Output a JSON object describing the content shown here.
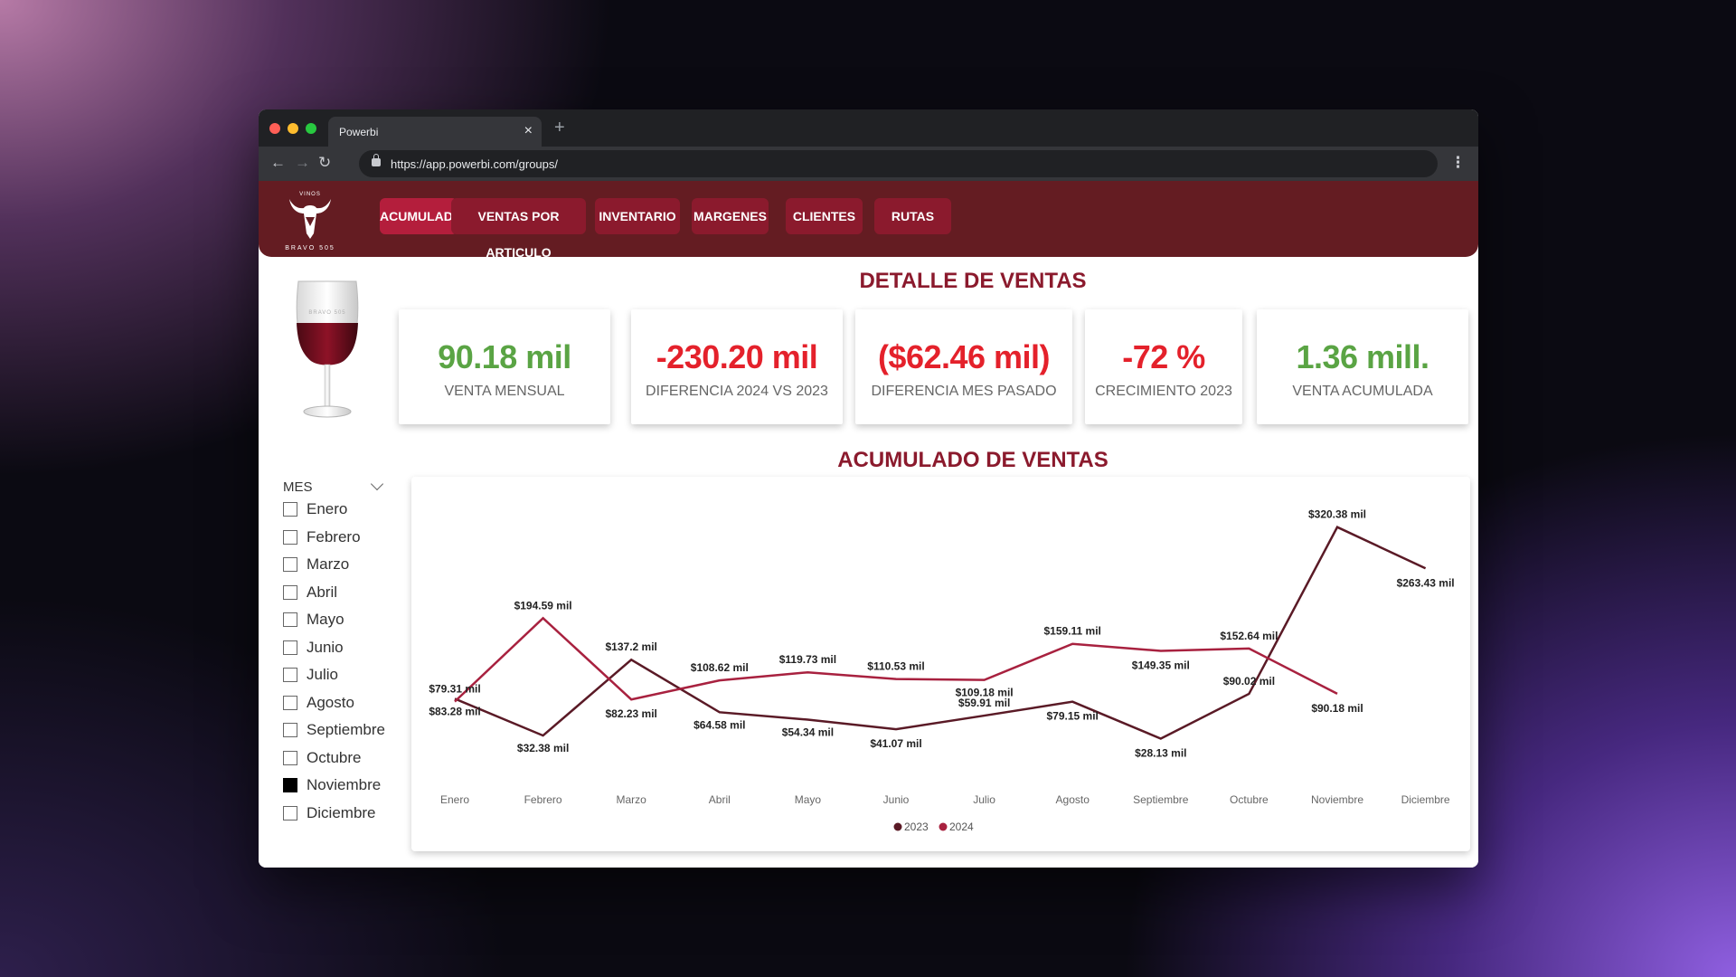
{
  "browser": {
    "tab_title": "Powerbi",
    "url": "https://app.powerbi.com/groups/"
  },
  "brand": {
    "logo_top": "VINOS",
    "logo_bottom": "BRAVO 505"
  },
  "nav": {
    "items": [
      {
        "label": "ACUMULADO",
        "active": true
      },
      {
        "label": "VENTAS POR ARTICULO",
        "active": false
      },
      {
        "label": "INVENTARIO",
        "active": false
      },
      {
        "label": "MARGENES",
        "active": false
      },
      {
        "label": "CLIENTES",
        "active": false
      },
      {
        "label": "RUTAS",
        "active": false
      }
    ]
  },
  "detail_title": "DETALLE DE VENTAS",
  "glass_text": "BRAVO 505",
  "kpis": [
    {
      "value": "90.18 mil",
      "label": "VENTA MENSUAL",
      "color": "#5aa444"
    },
    {
      "value": "-230.20 mil",
      "label": "DIFERENCIA 2024 VS 2023",
      "color": "#e4212b"
    },
    {
      "value": "($62.46 mil)",
      "label": "DIFERENCIA MES PASADO",
      "color": "#e4212b"
    },
    {
      "value": "-72 %",
      "label": "CRECIMIENTO 2023",
      "color": "#e4212b"
    },
    {
      "value": "1.36 mill.",
      "label": "VENTA ACUMULADA",
      "color": "#5aa444"
    }
  ],
  "chart_title": "ACUMULADO DE VENTAS",
  "filter": {
    "title": "MES",
    "items": [
      {
        "label": "Enero",
        "checked": false
      },
      {
        "label": "Febrero",
        "checked": false
      },
      {
        "label": "Marzo",
        "checked": false
      },
      {
        "label": "Abril",
        "checked": false
      },
      {
        "label": "Mayo",
        "checked": false
      },
      {
        "label": "Junio",
        "checked": false
      },
      {
        "label": "Julio",
        "checked": false
      },
      {
        "label": "Agosto",
        "checked": false
      },
      {
        "label": "Septiembre",
        "checked": false
      },
      {
        "label": "Octubre",
        "checked": false
      },
      {
        "label": "Noviembre",
        "checked": true
      },
      {
        "label": "Diciembre",
        "checked": false
      }
    ]
  },
  "chart_data": {
    "type": "line",
    "categories": [
      "Enero",
      "Febrero",
      "Marzo",
      "Abril",
      "Mayo",
      "Junio",
      "Julio",
      "Agosto",
      "Septiembre",
      "Octubre",
      "Noviembre",
      "Diciembre"
    ],
    "series": [
      {
        "name": "2023",
        "color": "#5a1a26",
        "values": [
          83.28,
          32.38,
          137.2,
          64.58,
          54.34,
          41.07,
          59.91,
          79.15,
          28.13,
          90.02,
          320.38,
          263.43
        ],
        "labels": [
          "$83.28 mil",
          "$32.38 mil",
          "$137.2 mil",
          "$64.58 mil",
          "$54.34 mil",
          "$41.07 mil",
          "$59.91 mil",
          "$79.15 mil",
          "$28.13 mil",
          "$90.02 mil",
          "$320.38 mil",
          "$263.43 mil"
        ]
      },
      {
        "name": "2024",
        "color": "#a8213f",
        "values": [
          79.31,
          194.59,
          82.23,
          108.62,
          119.73,
          110.53,
          109.18,
          159.11,
          149.35,
          152.64,
          90.18,
          null
        ],
        "labels": [
          "$79.31 mil",
          "$194.59 mil",
          "$82.23 mil",
          "$108.62 mil",
          "$119.73 mil",
          "$110.53 mil",
          "$109.18 mil",
          "$159.11 mil",
          "$149.35 mil",
          "$152.64 mil",
          "$90.18 mil",
          null
        ]
      }
    ],
    "ylim": [
      0,
      340
    ],
    "legend": "bottom-center",
    "grid": false
  }
}
